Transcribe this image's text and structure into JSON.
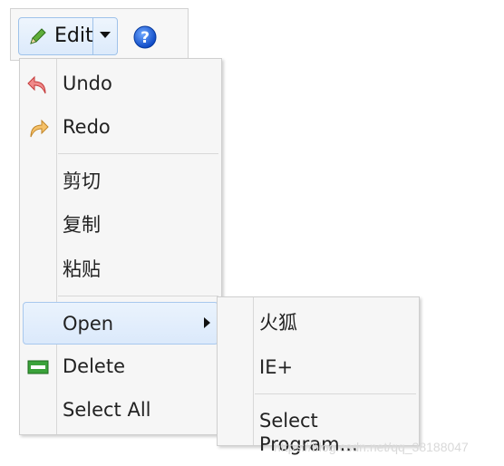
{
  "toolbar": {
    "edit_label": "Edit",
    "edit_icon": "pencil-icon",
    "dropdown_icon": "triangle-down-icon",
    "help_icon": "help-icon"
  },
  "menu": {
    "items": [
      {
        "label": "Undo",
        "icon": "undo-icon"
      },
      {
        "label": "Redo",
        "icon": "redo-icon"
      },
      {
        "label": "剪切"
      },
      {
        "label": "复制"
      },
      {
        "label": "粘贴"
      },
      {
        "label": "Open",
        "has_submenu": true
      },
      {
        "label": "Delete",
        "icon": "delete-icon"
      },
      {
        "label": "Select All"
      }
    ]
  },
  "submenu": {
    "items": [
      {
        "label": "火狐"
      },
      {
        "label": "IE+"
      },
      {
        "label": "Select Program..."
      }
    ]
  },
  "watermark": "https://blog.csdn.net/qq_38188047",
  "colors": {
    "accent_border": "#a8c8ee",
    "highlight_bg": "#dbe9fb",
    "menu_bg": "#f6f6f6"
  }
}
